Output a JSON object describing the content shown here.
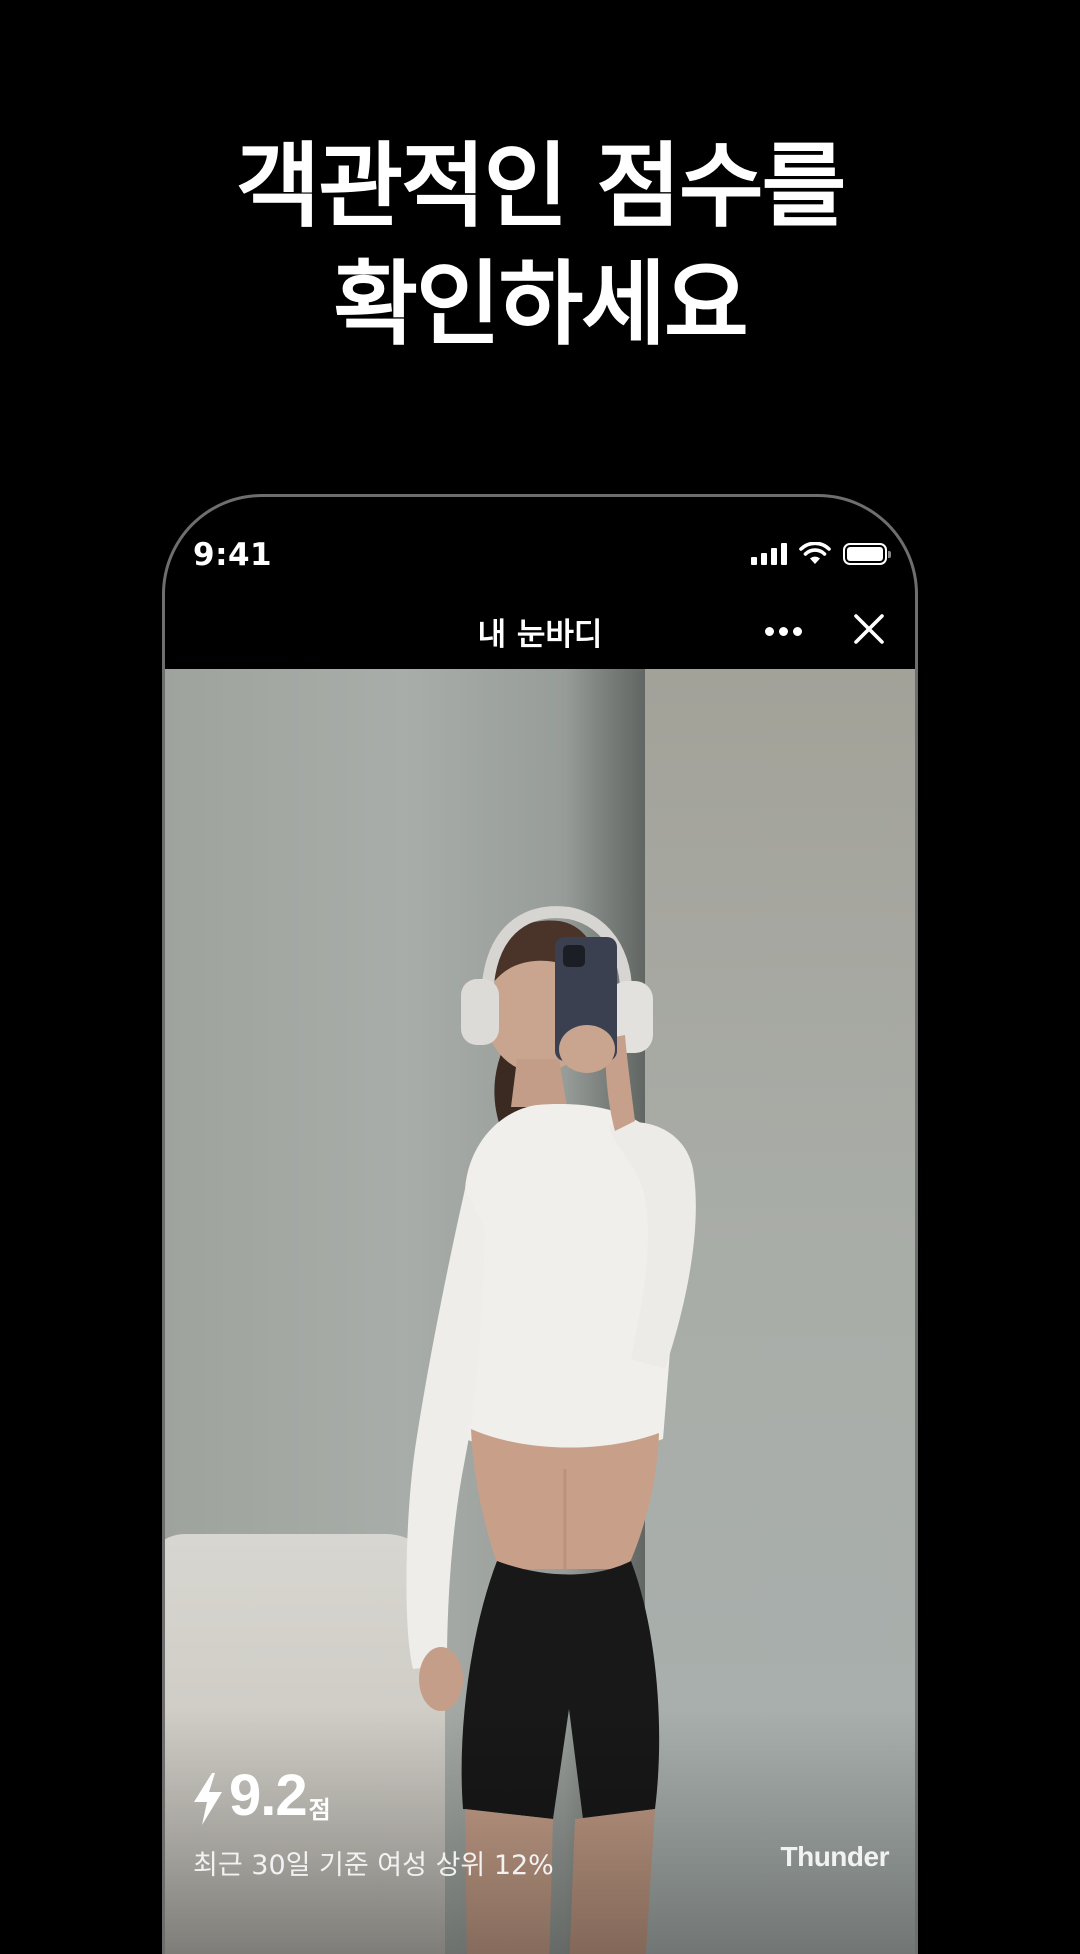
{
  "headline": {
    "line1": "객관적인 점수를",
    "line2": "확인하세요"
  },
  "status_bar": {
    "time": "9:41",
    "icons": [
      "cellular-signal-icon",
      "wifi-icon",
      "battery-icon"
    ]
  },
  "nav": {
    "title": "내 눈바디",
    "more_icon": "more-horizontal-icon",
    "close_icon": "close-icon"
  },
  "photo": {
    "subject": "mirror-selfie"
  },
  "score": {
    "icon": "lightning-bolt-icon",
    "value": "9.2",
    "unit": "점",
    "rank_text": "최근 30일 기준 여성 상위 12%"
  },
  "brand": {
    "name": "Thunder"
  },
  "colors": {
    "background": "#000000",
    "text": "#ffffff",
    "phone_frame": "#6e6e6e"
  }
}
